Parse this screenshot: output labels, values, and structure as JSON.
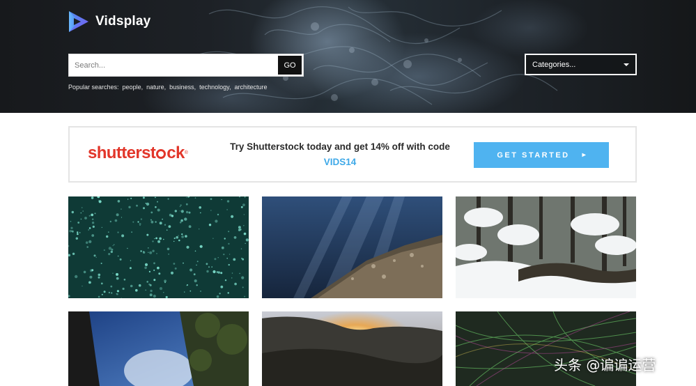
{
  "header": {
    "brand": "Vidsplay",
    "search": {
      "placeholder": "Search...",
      "value": "",
      "button_label": "GO"
    },
    "popular": {
      "label": "Popular searches:",
      "terms": [
        "people,",
        "nature,",
        "business,",
        "technology,",
        "architecture"
      ]
    },
    "categories": {
      "selected": "Categories..."
    }
  },
  "promo": {
    "brand_logo": "shutterstock",
    "text": "Try Shutterstock today and get 14% off with code ",
    "code": "VIDS14",
    "cta_label": "GET STARTED",
    "cta_icon": "arrow-right-icon",
    "accent": "#4fb3f0",
    "brand_color": "#e2362a"
  },
  "videos": [
    {
      "subject": "glowing particles on dark teal"
    },
    {
      "subject": "underwater sunlight over rock"
    },
    {
      "subject": "snowy forest stream"
    },
    {
      "subject": "sky through trees"
    },
    {
      "subject": "mountain sunset"
    },
    {
      "subject": "green light strands"
    }
  ],
  "watermark": "头条 @谝谝运营"
}
